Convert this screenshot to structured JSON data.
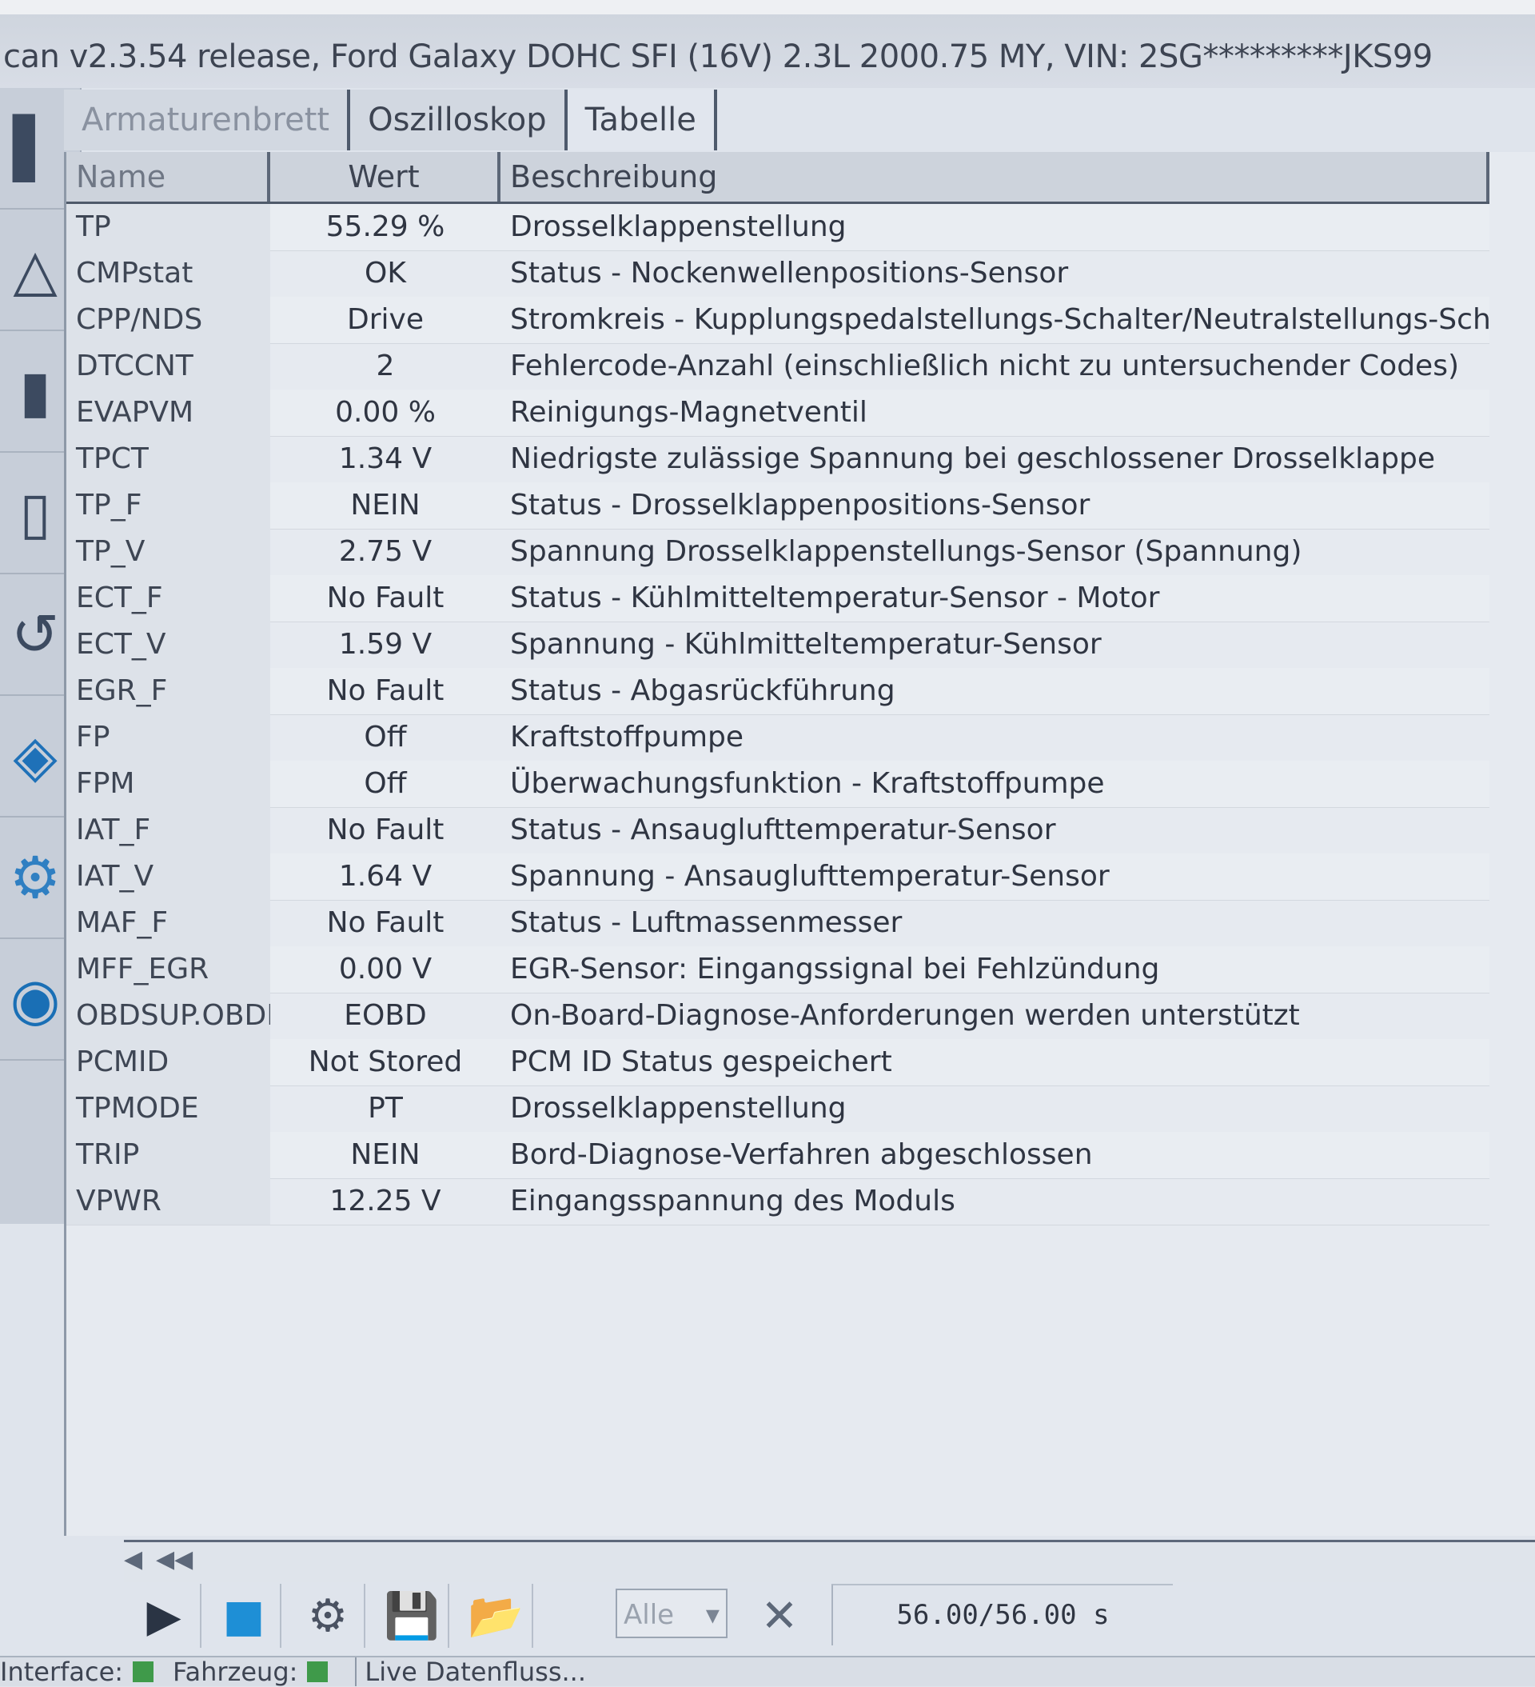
{
  "window": {
    "title": "can v2.3.54 release, Ford Galaxy DOHC SFI (16V) 2.3L 2000.75 MY, VIN: 2SG*********JKS99"
  },
  "tabs": [
    {
      "label": "Armaturenbrett",
      "state": "inactive-dim"
    },
    {
      "label": "Oszilloskop",
      "state": "inactive"
    },
    {
      "label": "Tabelle",
      "state": "active"
    }
  ],
  "table": {
    "headers": {
      "name": "Name",
      "wert": "Wert",
      "desc": "Beschreibung"
    },
    "rows": [
      {
        "name": "TP",
        "wert": "55.29 %",
        "desc": "Drosselklappenstellung"
      },
      {
        "name": "CMPstat",
        "wert": "OK",
        "desc": "Status - Nockenwellenpositions-Sensor"
      },
      {
        "name": "CPP/NDS",
        "wert": "Drive",
        "desc": "Stromkreis - Kupplungspedalstellungs-Schalter/Neutralstellungs-Schalter"
      },
      {
        "name": "DTCCNT",
        "wert": "2",
        "desc": "Fehlercode-Anzahl (einschließlich nicht zu untersuchender Codes)"
      },
      {
        "name": "EVAPVM",
        "wert": "0.00 %",
        "desc": "Reinigungs-Magnetventil"
      },
      {
        "name": "TPCT",
        "wert": "1.34 V",
        "desc": "Niedrigste zulässige Spannung bei geschlossener Drosselklappe"
      },
      {
        "name": "TP_F",
        "wert": "NEIN",
        "desc": "Status - Drosselklappenpositions-Sensor"
      },
      {
        "name": "TP_V",
        "wert": "2.75 V",
        "desc": "Spannung Drosselklappenstellungs-Sensor (Spannung)"
      },
      {
        "name": "ECT_F",
        "wert": "No Fault",
        "desc": "Status - Kühlmitteltemperatur-Sensor - Motor"
      },
      {
        "name": "ECT_V",
        "wert": "1.59 V",
        "desc": "Spannung - Kühlmitteltemperatur-Sensor"
      },
      {
        "name": "EGR_F",
        "wert": "No Fault",
        "desc": "Status - Abgasrückführung"
      },
      {
        "name": "FP",
        "wert": "Off",
        "desc": "Kraftstoffpumpe"
      },
      {
        "name": "FPM",
        "wert": "Off",
        "desc": "Überwachungsfunktion - Kraftstoffpumpe"
      },
      {
        "name": "IAT_F",
        "wert": "No Fault",
        "desc": "Status - Ansauglufttemperatur-Sensor"
      },
      {
        "name": "IAT_V",
        "wert": "1.64 V",
        "desc": "Spannung - Ansauglufttemperatur-Sensor"
      },
      {
        "name": "MAF_F",
        "wert": "No Fault",
        "desc": "Status - Luftmassenmesser"
      },
      {
        "name": "MFF_EGR",
        "wert": "0.00 V",
        "desc": "EGR-Sensor: Eingangssignal bei Fehlzündung"
      },
      {
        "name": "OBDSUP.OBDII",
        "wert": "EOBD",
        "desc": "On-Board-Diagnose-Anforderungen werden unterstützt"
      },
      {
        "name": "PCMID",
        "wert": "Not Stored",
        "desc": "PCM ID Status gespeichert"
      },
      {
        "name": "TPMODE",
        "wert": "PT",
        "desc": "Drosselklappenstellung"
      },
      {
        "name": "TRIP",
        "wert": "NEIN",
        "desc": "Bord-Diagnose-Verfahren abgeschlossen"
      },
      {
        "name": "VPWR",
        "wert": "12.25 V",
        "desc": "Eingangsspannung des Moduls"
      }
    ]
  },
  "toolbar": {
    "play_icon": "▶",
    "stop_icon": "■",
    "settings_icon": "⚙",
    "save_icon": "💾",
    "open_icon": "📂",
    "filter_value": "Alle",
    "clear_icon": "✕",
    "time": "56.00/56.00 s"
  },
  "scroll": {
    "left_icon": "◀",
    "first_icon": "◀◀"
  },
  "statusbar": {
    "interface_label": "Interface:",
    "vehicle_label": "Fahrzeug:",
    "stream_label": "Live Datenfluss..."
  },
  "colors": {
    "status_ok": "#3f9a4a",
    "accent_blue": "#1f71b8"
  }
}
